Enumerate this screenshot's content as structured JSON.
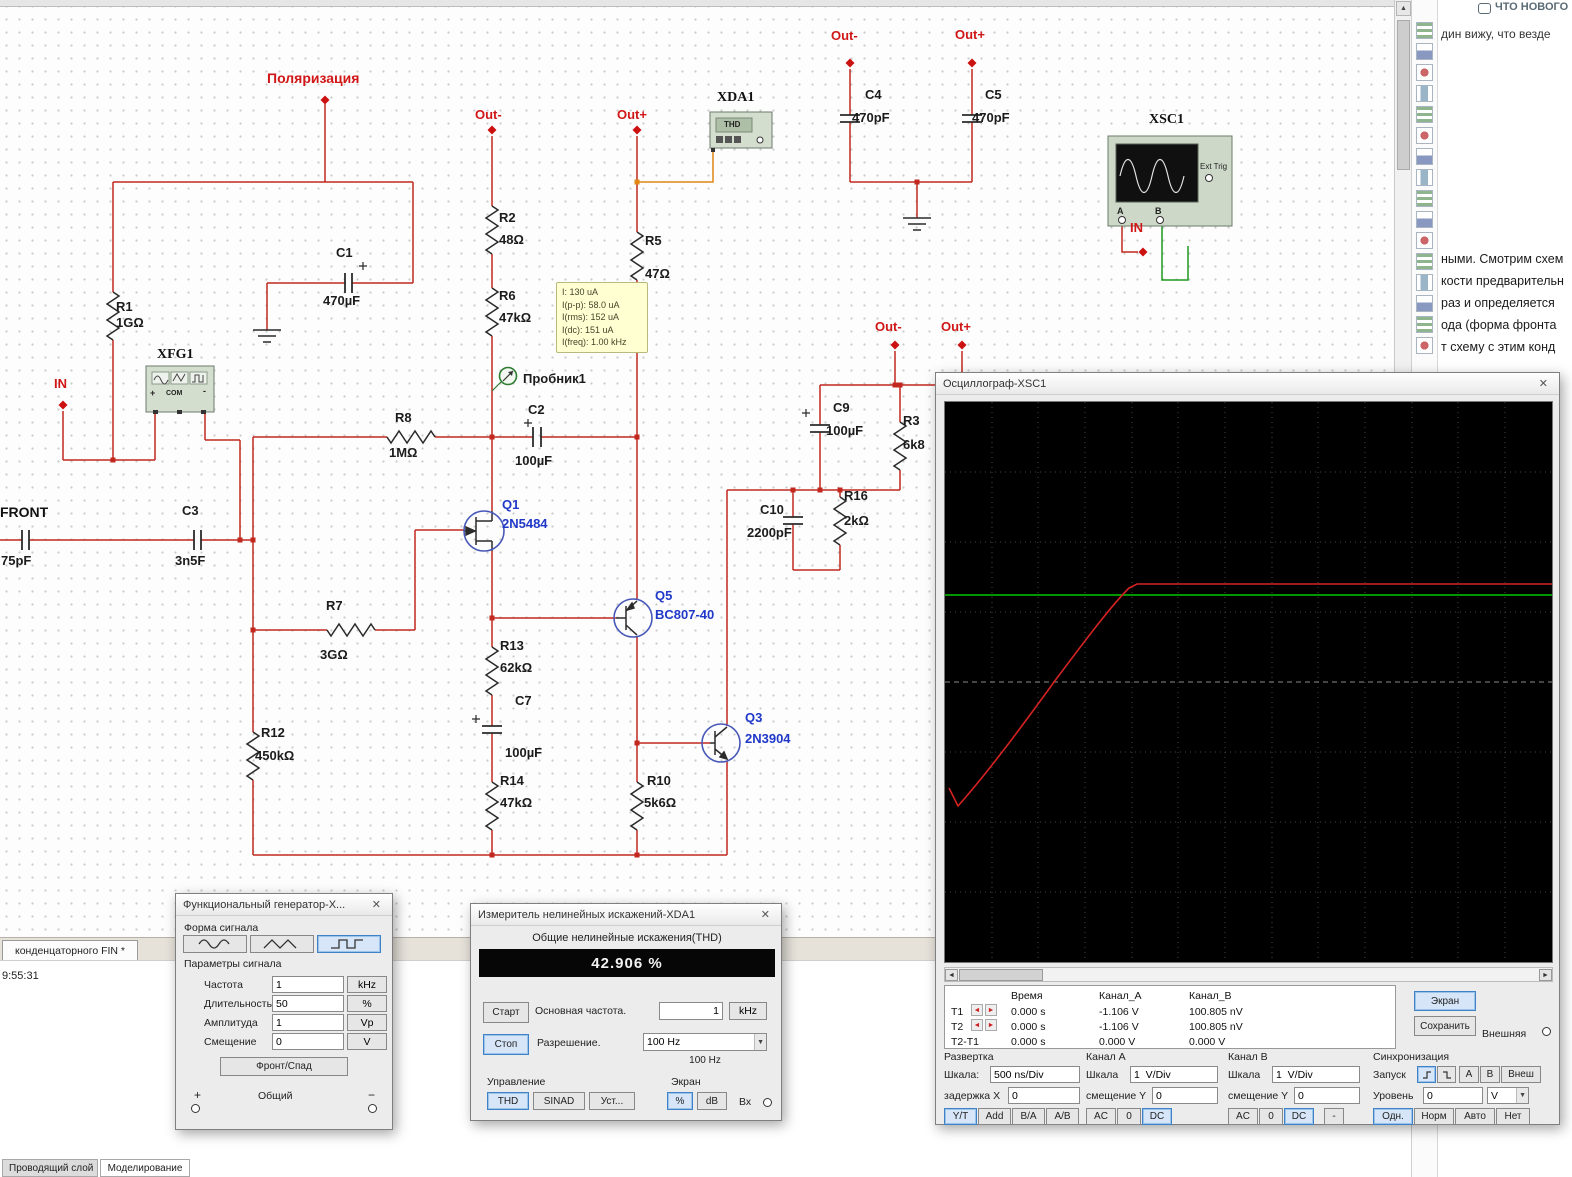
{
  "icons": {
    "close": "✕",
    "dropdown": "▼",
    "arrow_left": "◄",
    "arrow_right": "►",
    "arrow_up": "▲"
  },
  "canvas": {
    "nets": {
      "polarization": "Поляризация",
      "out_minus": "Out-",
      "out_plus": "Out+",
      "in": "IN",
      "front": "FRONT"
    },
    "components": {
      "R1": {
        "ref": "R1",
        "val": "1GΩ"
      },
      "C1": {
        "ref": "C1",
        "val": "470µF"
      },
      "R2": {
        "ref": "R2",
        "val": "48Ω"
      },
      "R6": {
        "ref": "R6",
        "val": "47kΩ"
      },
      "R5": {
        "ref": "R5",
        "val": "47Ω"
      },
      "C4": {
        "ref": "C4",
        "val": "470pF"
      },
      "C5": {
        "ref": "C5",
        "val": "470pF"
      },
      "C9": {
        "ref": "C9",
        "val": "100µF"
      },
      "R3": {
        "ref": "R3",
        "val": "6k8"
      },
      "C2": {
        "ref": "C2",
        "val": "100µF"
      },
      "R8": {
        "ref": "R8",
        "val": "1MΩ"
      },
      "Q1": {
        "ref": "Q1",
        "val": "2N5484"
      },
      "C10": {
        "ref": "C10",
        "val": "2200pF"
      },
      "R16": {
        "ref": "R16",
        "val": "2kΩ"
      },
      "C3": {
        "ref": "C3",
        "val": "3n5F"
      },
      "CIN": {
        "ref": "",
        "val": "75pF"
      },
      "R7": {
        "ref": "R7",
        "val": "3GΩ"
      },
      "Q5": {
        "ref": "Q5",
        "val": "BC807-40"
      },
      "R13": {
        "ref": "R13",
        "val": "62kΩ"
      },
      "C7": {
        "ref": "C7",
        "val": "100µF"
      },
      "Q3": {
        "ref": "Q3",
        "val": "2N3904"
      },
      "R12": {
        "ref": "R12",
        "val": "450kΩ"
      },
      "R14": {
        "ref": "R14",
        "val": "47kΩ"
      },
      "R10": {
        "ref": "R10",
        "val": "5k6Ω"
      },
      "XFG1": {
        "ref": "XFG1"
      },
      "XDA1": {
        "ref": "XDA1"
      },
      "XSC1": {
        "ref": "XSC1"
      }
    },
    "instrument_icons": {
      "xda1_display": "THD",
      "ext_trig": "Ext Trig",
      "term_a": "A",
      "term_b": "B",
      "com": "COM",
      "plus": "+",
      "minus": "-"
    },
    "probe": {
      "label": "Пробник1",
      "tooltip": [
        "I: 130 uA",
        "I(p-p): 58.0 uA",
        "I(rms): 152 uA",
        "I(dc): 151 uA",
        "I(freq): 1.00 kHz"
      ]
    }
  },
  "oscilloscope": {
    "title": "Осциллограф-XSC1",
    "readout": {
      "headers": {
        "time": "Время",
        "cha": "Канал_A",
        "chb": "Канал_B"
      },
      "t1": {
        "label": "T1",
        "time": "0.000 s",
        "cha": "-1.106 V",
        "chb": "100.805 nV"
      },
      "t2": {
        "label": "T2",
        "time": "0.000 s",
        "cha": "-1.106 V",
        "chb": "100.805 nV"
      },
      "dt": {
        "label": "T2-T1",
        "time": "0.000 s",
        "cha": "0.000 V",
        "chb": "0.000 V"
      }
    },
    "buttons": {
      "screen": "Экран",
      "save": "Сохранить"
    },
    "external_label": "Внешняя",
    "timebase": {
      "title": "Развертка",
      "scale_label": "Шкала:",
      "scale_value": "500 ns/Div",
      "delay_label": "задержка X",
      "delay_value": "0",
      "mode_yt": "Y/T",
      "mode_add": "Add",
      "mode_ba": "B/A",
      "mode_ab": "A/B"
    },
    "channel_a": {
      "title": "Канал A",
      "scale_label": "Шкала",
      "scale_value": "1  V/Div",
      "offset_label": "смещение Y",
      "offset_value": "0",
      "ac": "AC",
      "zero": "0",
      "dc": "DC"
    },
    "channel_b": {
      "title": "Канал B",
      "scale_label": "Шкала",
      "scale_value": "1  V/Div",
      "offset_label": "смещение Y",
      "offset_value": "0",
      "ac": "AC",
      "zero": "0",
      "dc": "DC",
      "minus": "-"
    },
    "trigger": {
      "title": "Синхронизация",
      "start_label": "Запуск",
      "edge_a": "A",
      "edge_b": "B",
      "edge_ext": "Внеш",
      "level_label": "Уровень",
      "level_value": "0",
      "level_unit": "V",
      "single": "Одн.",
      "normal": "Норм",
      "auto": "Авто",
      "none": "Нет"
    }
  },
  "thd_meter": {
    "title": "Измеритель нелинейных искажений-XDA1",
    "heading": "Общие нелинейные искажения(THD)",
    "reading": "42.906 %",
    "start": "Старт",
    "stop": "Стоп",
    "fundamental_label": "Основная частота.",
    "fundamental_value": "1",
    "fundamental_unit": "kHz",
    "resolution_label": "Разрешение.",
    "resolution_value": "100 Hz",
    "resolution_info": "100 Hz",
    "control_label": "Управление",
    "btn_thd": "THD",
    "btn_sinad": "SINAD",
    "btn_set": "Уст...",
    "display_label": "Экран",
    "btn_pct": "%",
    "btn_db": "dB",
    "input_label": "Вх"
  },
  "function_generator": {
    "title": "Функциональный генератор-X...",
    "waveform_label": "Форма сигнала",
    "params_label": "Параметры сигнала",
    "freq_label": "Частота",
    "freq_value": "1",
    "freq_unit": "kHz",
    "duty_label": "Длительность",
    "duty_value": "50",
    "duty_unit": "%",
    "amp_label": "Амплитуда",
    "amp_value": "1",
    "amp_unit": "Vp",
    "offset_label": "Смещение",
    "offset_value": "0",
    "offset_unit": "V",
    "edge_button": "Фронт/Спад",
    "plus": "+",
    "common": "Общий",
    "minus": "−"
  },
  "side_panel": {
    "whats_new": "ЧТО НОВОГО",
    "top_line": "дин вижу, что везде",
    "para_1": "ными. Смотрим схем",
    "para_2": "кости предварительн",
    "para_3": "раз и определяется",
    "para_4": "ода (форма фронта",
    "para_5": "т схему с этим конд"
  },
  "bottom": {
    "doc_tab": "конденцаторного FIN *",
    "timestamp": "9:55:31",
    "sheet_tab_1": "Проводящий слой",
    "sheet_tab_2": "Моделирование"
  }
}
